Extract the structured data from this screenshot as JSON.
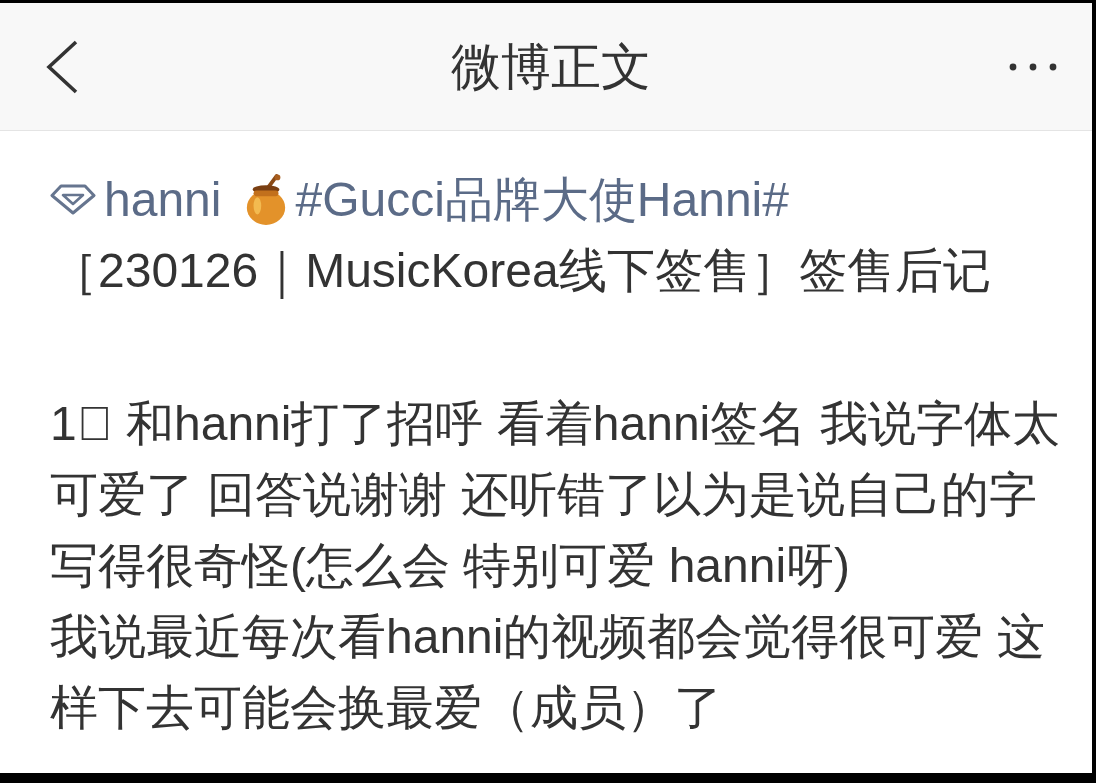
{
  "top_bar": {
    "title": "微博正文"
  },
  "post": {
    "author": "hanni",
    "hashtag": "#Gucci品牌大使Hanni#",
    "heading": "［230126｜MusicKorea线下签售］签售后记",
    "paragraphs": [
      "1⃣ 和hanni打了招呼 看着hanni签名 我说字体太可爱了 回答说谢谢 还听错了以为是说自己的字写得很奇怪(怎么会 特别可爱 hanni呀)",
      "我说最近每次看hanni的视频都会觉得很可爱 这样下去可能会换最爱（成员）了"
    ]
  }
}
